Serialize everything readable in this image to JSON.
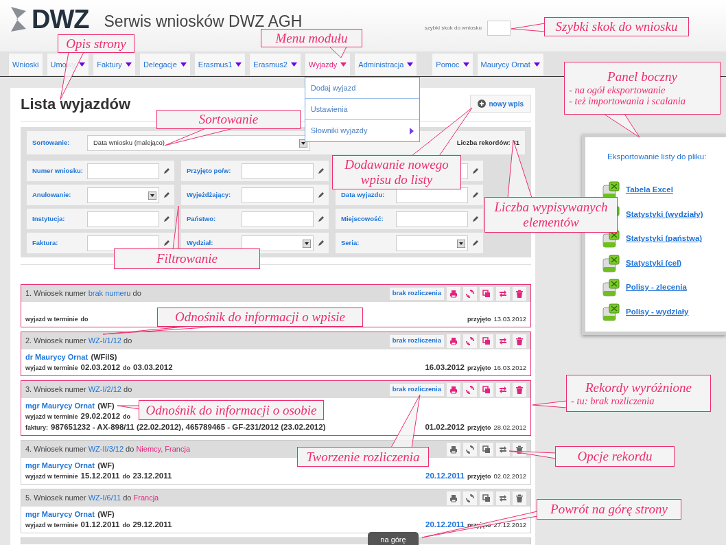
{
  "header": {
    "logo": "DWZ",
    "title": "Serwis wniosków DWZ AGH",
    "quick_jump": {
      "label": "szybki skok do wniosku"
    }
  },
  "nav": [
    {
      "label": "Wnioski",
      "selected": false,
      "dropdown": false
    },
    {
      "label": "Umowy",
      "selected": false,
      "dropdown": true
    },
    {
      "label": "Faktury",
      "selected": false,
      "dropdown": true
    },
    {
      "label": "Delegacje",
      "selected": false,
      "dropdown": true
    },
    {
      "label": "Erasmus1",
      "selected": false,
      "dropdown": true
    },
    {
      "label": "Erasmus2",
      "selected": false,
      "dropdown": true
    },
    {
      "label": "Wyjazdy",
      "selected": true,
      "dropdown": true
    },
    {
      "label": "Administracja",
      "selected": false,
      "dropdown": true
    },
    {
      "label": "Pomoc",
      "selected": false,
      "dropdown": true
    },
    {
      "label": "Maurycy Ornat",
      "selected": false,
      "dropdown": true
    }
  ],
  "module_menu": [
    {
      "label": "Dodaj wyjazd",
      "submenu": false
    },
    {
      "label": "Ustawienia",
      "submenu": false
    },
    {
      "label": "Słowniki wyjazdy",
      "submenu": true
    }
  ],
  "page": {
    "title": "Lista wyjazdów",
    "new_button": "nowy wpis",
    "sort": {
      "label": "Sortowanie:",
      "value": "Data wniosku (malejąco)"
    },
    "record_count": "Liczba rekordów: 31",
    "filters": [
      {
        "label": "Numer wniosku:",
        "kind": "text"
      },
      {
        "label": "Przyjęto po/w:",
        "kind": "text"
      },
      {
        "kind": "text"
      },
      {
        "label": "Anulowanie:",
        "kind": "select"
      },
      {
        "label": "Wyjeżdżający:",
        "kind": "text"
      },
      {
        "label": "Data wyjazdu:",
        "kind": "text"
      },
      {
        "label": "Instytucja:",
        "kind": "text"
      },
      {
        "label": "Państwo:",
        "kind": "text"
      },
      {
        "label": "Miejscowość:",
        "kind": "text"
      },
      {
        "label": "Faktura:",
        "kind": "text"
      },
      {
        "label": "Wydział:",
        "kind": "select"
      },
      {
        "label": "Seria:",
        "kind": "select"
      }
    ],
    "records": [
      {
        "prefix": "1. Wniosek numer",
        "number": "brak numeru",
        "to": "do",
        "highlighted": true,
        "settlement": "brak rozliczenia",
        "term_label": "wyjazd w terminie",
        "until": "do",
        "accepted_label": "przyjęto",
        "accepted_date": "13.03.2012"
      },
      {
        "prefix": "2. Wniosek numer",
        "number": "WZ-I/1/12",
        "to": "do",
        "highlighted": true,
        "settlement": "brak rozliczenia",
        "person": "dr Maurycy Ornat",
        "unit": "(WFiIS)",
        "term_label": "wyjazd w terminie",
        "start": "02.03.2012",
        "until": "do",
        "end": "03.03.2012",
        "date": "16.03.2012",
        "date_linked": false,
        "accepted_label": "przyjęto",
        "accepted_date": "16.03.2012"
      },
      {
        "prefix": "3. Wniosek numer",
        "number": "WZ-I/2/12",
        "to": "do",
        "highlighted": true,
        "settlement": "brak rozliczenia",
        "person": "mgr Maurycy Ornat",
        "unit": "(WF)",
        "term_label": "wyjazd w terminie",
        "start": "29.02.2012",
        "until": "do",
        "invoices_label": "faktury:",
        "invoices": "987651232 - AX-898/11 (22.02.2012), 465789465 - GF-231/2012 (23.02.2012)",
        "date": "01.02.2012",
        "date_linked": false,
        "accepted_label": "przyjęto",
        "accepted_date": "28.02.2012"
      },
      {
        "prefix": "4. Wniosek numer",
        "number": "WZ-II/3/12",
        "to": "do",
        "countries": "Niemcy, Francja",
        "highlighted": false,
        "person": "mgr Maurycy Ornat",
        "unit": "(WF)",
        "term_label": "wyjazd w terminie",
        "start": "15.12.2011",
        "until": "do",
        "end": "23.12.2011",
        "date": "20.12.2011",
        "date_linked": true,
        "accepted_label": "przyjęto",
        "accepted_date": "02.02.2012"
      },
      {
        "prefix": "5. Wniosek numer",
        "number": "WZ-I/6/11",
        "to": "do",
        "countries": "Francja",
        "highlighted": false,
        "person": "mgr Maurycy Ornat",
        "unit": "(WF)",
        "term_label": "wyjazd w terminie",
        "start": "01.12.2011",
        "until": "do",
        "end": "29.12.2011",
        "date": "20.12.2011",
        "date_linked": true,
        "accepted_label": "przyjęto",
        "accepted_date": "27.12.2012"
      }
    ]
  },
  "side_panel": {
    "heading": "Eksportowanie listy do pliku:",
    "links": [
      "Tabela Excel",
      "Statystyki (wydziały)",
      "Statystyki (państwa)",
      "Statystyki (cel)",
      "Polisy - zlecenia",
      "Polisy - wydziały"
    ]
  },
  "back_to_top": "na górę",
  "callouts": [
    {
      "title": "Opis strony"
    },
    {
      "title": "Menu modułu"
    },
    {
      "title": "Szybki skok do wniosku"
    },
    {
      "title": "Panel boczny",
      "notes": [
        "- na ogół eksportowanie",
        "- też importowania i scalania"
      ]
    },
    {
      "title": "Sortowanie"
    },
    {
      "title": "Dodawanie nowego wpisu do listy"
    },
    {
      "title": "Liczba wypisywanych elementów"
    },
    {
      "title": "Filtrowanie"
    },
    {
      "title": "Odnośnik do informacji o wpisie"
    },
    {
      "title": "Rekordy wyróżnione",
      "notes": [
        "- tu: brak rozliczenia"
      ]
    },
    {
      "title": "Odnośnik do informacji o osobie"
    },
    {
      "title": "Tworzenie rozliczenia"
    },
    {
      "title": "Opcje rekordu"
    },
    {
      "title": "Powrót na górę strony"
    }
  ]
}
